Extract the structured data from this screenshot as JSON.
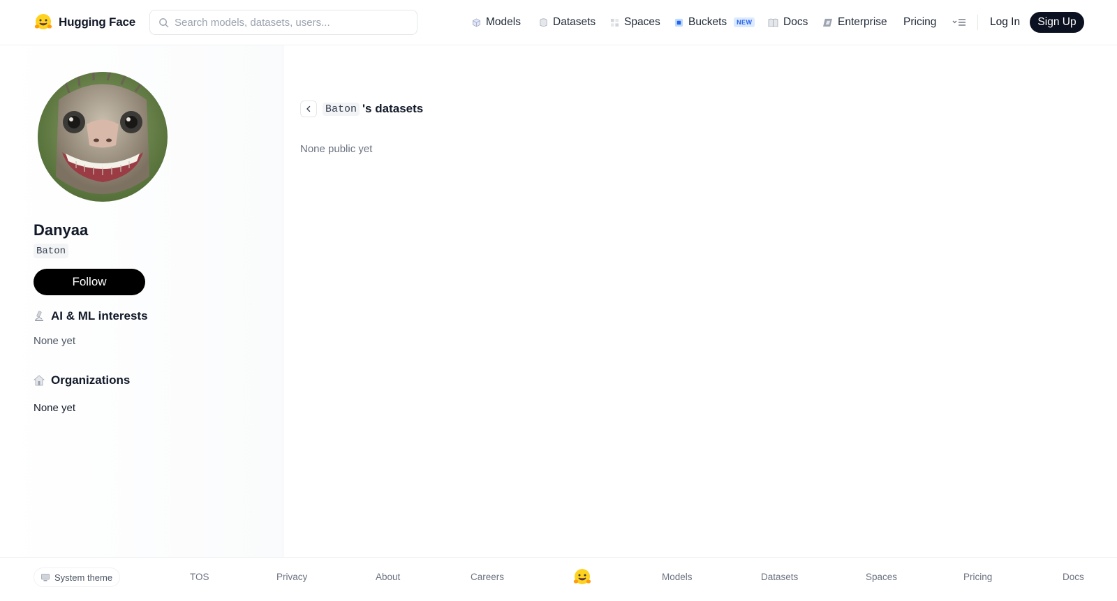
{
  "header": {
    "brand": "Hugging Face",
    "search_placeholder": "Search models, datasets, users...",
    "nav": [
      {
        "label": "Models",
        "icon": "cube-icon"
      },
      {
        "label": "Datasets",
        "icon": "database-icon"
      },
      {
        "label": "Spaces",
        "icon": "grid-icon"
      },
      {
        "label": "Buckets",
        "icon": "bucket-icon",
        "badge": "NEW"
      },
      {
        "label": "Docs",
        "icon": "book-icon"
      },
      {
        "label": "Enterprise",
        "icon": "enterprise-icon"
      },
      {
        "label": "Pricing"
      }
    ],
    "login": "Log In",
    "signup": "Sign Up"
  },
  "profile": {
    "full_name": "Danyaa",
    "username": "Baton",
    "follow_label": "Follow",
    "interests_title": "AI & ML interests",
    "interests_value": "None yet",
    "orgs_title": "Organizations",
    "orgs_value": "None yet"
  },
  "main": {
    "username_chip": "Baton",
    "title_suffix": "'s datasets",
    "empty_text": "None public yet"
  },
  "footer": {
    "theme_label": "System theme",
    "links": [
      "TOS",
      "Privacy",
      "About",
      "Careers",
      "Models",
      "Datasets",
      "Spaces",
      "Pricing",
      "Docs"
    ]
  },
  "colors": {
    "brand_yellow": "#FFD21E",
    "primary_dark": "#0B1120",
    "buckets_blue": "#2563EB"
  }
}
